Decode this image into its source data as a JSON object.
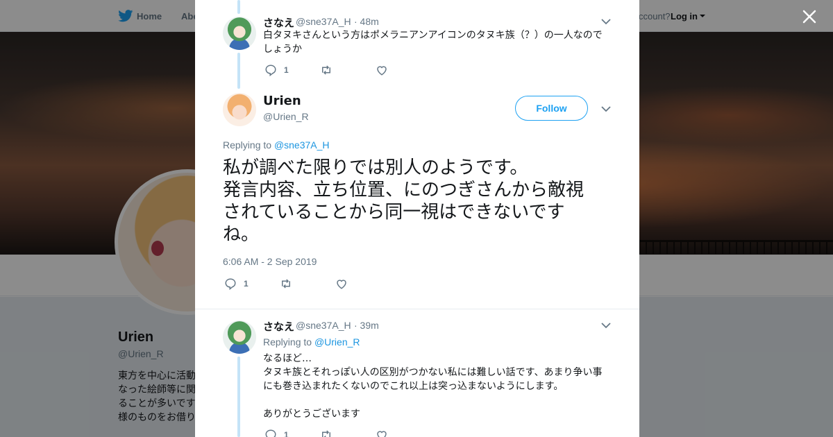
{
  "background_page": {
    "nav": {
      "home_label": "Home",
      "about_label": "Abo",
      "account_text": "ccount?",
      "login_label": "Log in"
    },
    "profile": {
      "name": "Urien",
      "handle": "@Urien_R",
      "bio": "東方を中心に活動\nなった絵師等に関\nることが多いです\n様のものをお借り"
    }
  },
  "modal": {
    "tweets_above": [
      {
        "name": "さなえ",
        "handle": "@sne37A_H",
        "time": "· 48m",
        "text": "白タヌキさんという方はポメラニアンアイコンのタヌキ族（？）の一人なので\nしょうか",
        "reply_count": "1"
      }
    ],
    "main_tweet": {
      "name": "Urien",
      "handle": "@Urien_R",
      "follow_label": "Follow",
      "replying_prefix": "Replying to",
      "replying_to": "@sne37A_H",
      "text": "私が調べた限りでは別人のようです。\n発言内容、立ち位置、にのつぎさんから敵視\nされていることから同一視はできないです\nね。",
      "timestamp": "6:06 AM - 2 Sep 2019",
      "reply_count": "1"
    },
    "replies": [
      {
        "name": "さなえ",
        "handle": "@sne37A_H",
        "time": "· 39m",
        "replying_prefix": "Replying to",
        "replying_to": "@Urien_R",
        "text": "なるほど…\nタヌキ族とそれっぽい人の区別がつかない私には難しい話です、あまり争い事\nにも巻き込まれたくないのでこれ以上は突っ込まないようにします。\n\nありがとうございます",
        "reply_count": "1"
      }
    ]
  },
  "colors": {
    "accent": "#1da1f2",
    "link": "#1b95e0",
    "thread_line": "#c4e3f7",
    "muted": "#657786"
  },
  "icons": [
    "twitter-bird-icon",
    "close-icon",
    "chevron-down-icon",
    "reply-icon",
    "retweet-icon",
    "like-icon"
  ]
}
